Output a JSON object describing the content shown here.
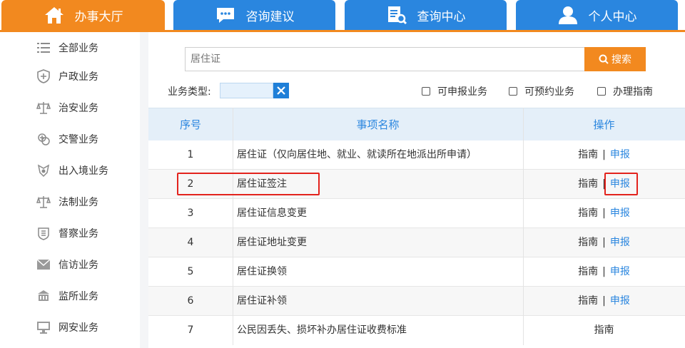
{
  "tabs": [
    {
      "label": "办事大厅",
      "icon": "home-icon",
      "active": true
    },
    {
      "label": "咨询建议",
      "icon": "chat-bubble-icon",
      "active": false
    },
    {
      "label": "查询中心",
      "icon": "document-search-icon",
      "active": false
    },
    {
      "label": "个人中心",
      "icon": "user-icon",
      "active": false
    }
  ],
  "sidebar": {
    "items": [
      {
        "label": "全部业务",
        "icon": "list-icon"
      },
      {
        "label": "户政业务",
        "icon": "shield-icon"
      },
      {
        "label": "治安业务",
        "icon": "scales-icon"
      },
      {
        "label": "交警业务",
        "icon": "traffic-icon"
      },
      {
        "label": "出入境业务",
        "icon": "badge-icon"
      },
      {
        "label": "法制业务",
        "icon": "scales-icon"
      },
      {
        "label": "督察业务",
        "icon": "emblem-icon"
      },
      {
        "label": "信访业务",
        "icon": "mail-icon"
      },
      {
        "label": "监所业务",
        "icon": "building-icon"
      },
      {
        "label": "网安业务",
        "icon": "monitor-icon"
      }
    ]
  },
  "search": {
    "value": "居住证",
    "button_label": "搜索"
  },
  "filters": {
    "type_label": "业务类型:",
    "checkboxes": [
      "可申报业务",
      "可预约业务",
      "办理指南"
    ]
  },
  "table": {
    "headers": [
      "序号",
      "事项名称",
      "操作"
    ],
    "rows": [
      {
        "num": "1",
        "name": "居住证（仅向居住地、就业、就读所在地派出所申请）",
        "guide": "指南",
        "sep": "|",
        "apply": "申报"
      },
      {
        "num": "2",
        "name": "居住证签注",
        "guide": "指南",
        "sep": "|",
        "apply": "申报"
      },
      {
        "num": "3",
        "name": "居住证信息变更",
        "guide": "指南",
        "sep": "|",
        "apply": "申报"
      },
      {
        "num": "4",
        "name": "居住证地址变更",
        "guide": "指南",
        "sep": "|",
        "apply": "申报"
      },
      {
        "num": "5",
        "name": "居住证换领",
        "guide": "指南",
        "sep": "|",
        "apply": "申报"
      },
      {
        "num": "6",
        "name": "居住证补领",
        "guide": "指南",
        "sep": "|",
        "apply": "申报"
      },
      {
        "num": "7",
        "name": "公民因丢失、损坏补办居住证收费标准",
        "guide": "指南"
      }
    ]
  },
  "colors": {
    "accent_orange": "#f2891f",
    "accent_blue": "#2a86df",
    "highlight_red": "#e3231d"
  }
}
